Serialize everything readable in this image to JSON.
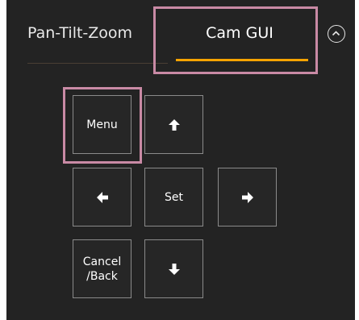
{
  "tabs": {
    "ptz_label": "Pan-Tilt-Zoom",
    "cam_gui_label": "Cam GUI",
    "active_underline_color": "#f5a300"
  },
  "collapse_button": {
    "icon": "chevron-up-circle-icon"
  },
  "controls": {
    "menu_label": "Menu",
    "up_icon": "arrow-up-icon",
    "left_icon": "arrow-left-icon",
    "set_label": "Set",
    "right_icon": "arrow-right-icon",
    "cancel_label_line1": "Cancel",
    "cancel_label_line2": "/Back",
    "down_icon": "arrow-down-icon"
  },
  "highlight_color": "#c98aa5"
}
